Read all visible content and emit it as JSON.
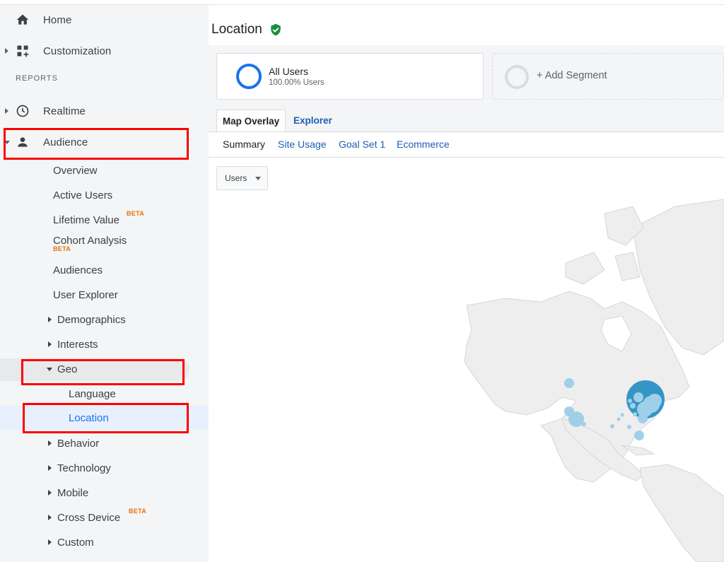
{
  "sidebar": {
    "home_label": "Home",
    "customization_label": "Customization",
    "reports_section": "REPORTS",
    "realtime_label": "Realtime",
    "audience_label": "Audience",
    "audience_items": {
      "overview": "Overview",
      "active_users": "Active Users",
      "lifetime_value": "Lifetime Value",
      "cohort_analysis": "Cohort Analysis",
      "audiences": "Audiences",
      "user_explorer": "User Explorer",
      "demographics": "Demographics",
      "interests": "Interests",
      "geo": "Geo",
      "language": "Language",
      "location": "Location",
      "behavior": "Behavior",
      "technology": "Technology",
      "mobile": "Mobile",
      "cross_device": "Cross Device",
      "custom": "Custom"
    },
    "beta_badge": "BETA"
  },
  "main": {
    "page_title": "Location",
    "segment": {
      "name": "All Users",
      "percent": "100.00% Users"
    },
    "add_segment_label": "+ Add Segment",
    "tabs": {
      "active": "Map Overlay",
      "other": "Explorer"
    },
    "subtabs": [
      "Summary",
      "Site Usage",
      "Goal Set 1",
      "Ecommerce"
    ],
    "metric_selector": "Users"
  },
  "colors": {
    "accent": "#1a73e8",
    "link": "#1a5fb4",
    "beta": "#e8710a",
    "highlight_box": "#ff0000",
    "verified": "#1e8e3e",
    "map_land": "#eeeeee",
    "map_bubble_main": "#2a8fc4",
    "map_bubble_light": "#9fd0ea"
  },
  "icons": {
    "home": "home-icon",
    "customization": "dashboard-plus-icon",
    "realtime": "clock-icon",
    "audience": "person-icon",
    "verified": "shield-check-icon"
  }
}
